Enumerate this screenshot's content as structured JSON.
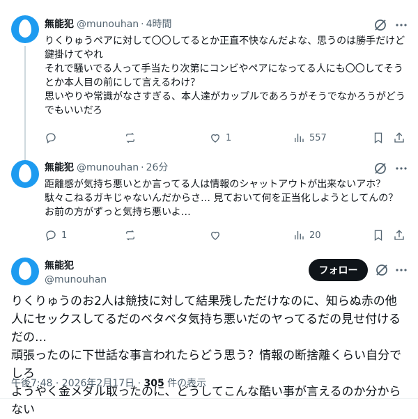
{
  "tweets": [
    {
      "name": "無能犯",
      "handle": "@munouhan",
      "sep": "·",
      "time": "4時間",
      "text": "りくりゅうペアに対して〇〇してるとか正直不快なんだよな、思うのは勝手だけど鍵掛けてやれ\nそれで騒いでる人って手当たり次第にコンビやペアになってる人にも〇〇してそうとか本人目の前にして言えるわけ？\n思いやりや常識がなさすぎる、本人達がカップルであろうがそうでなかろうがどうでもいいだろ",
      "replies": "",
      "retweets": "",
      "likes": "1",
      "views": "557"
    },
    {
      "name": "無能犯",
      "handle": "@munouhan",
      "sep": "·",
      "time": "26分",
      "text": "距離感が気持ち悪いとか言ってる人は情報のシャットアウトが出来ないアホ？\n駄々こねるガキじゃないんだからさ… 見ておいて何を正当化しようとしてんの？お前の方がずっと気持ち悪いよ…",
      "replies": "1",
      "retweets": "",
      "likes": "",
      "views": "20"
    }
  ],
  "main": {
    "name": "無能犯",
    "handle": "@munouhan",
    "follow_label": "フォロー",
    "text": "りくりゅうのお2人は競技に対して結果残しただけなのに、知らぬ赤の他人にセックスしてるだのベタベタ気持ち悪いだのヤってるだの見せ付けるだの…\n頑張ったのに下世話な事言われたらどう思う？情報の断捨離くらい自分でしろ\nようやく金メダル取ったのに、どうしてこんな酷い事が言えるのか分からない",
    "time": "午後7:48 · 2026年2月17日 · ",
    "views_count": "305",
    "views_suffix": " 件の表示"
  },
  "icons": {
    "avatar": "default-egg-avatar",
    "grok": "grok-icon",
    "more": "more-horizontal-icon",
    "reply": "reply-icon",
    "retweet": "retweet-icon",
    "like": "heart-icon",
    "views": "views-icon",
    "bookmark": "bookmark-icon",
    "share": "share-icon"
  },
  "colors": {
    "avatar_bg": "#1d9bf0",
    "text": "#0f1419",
    "secondary": "#536471",
    "follow_bg": "#0f1419"
  }
}
